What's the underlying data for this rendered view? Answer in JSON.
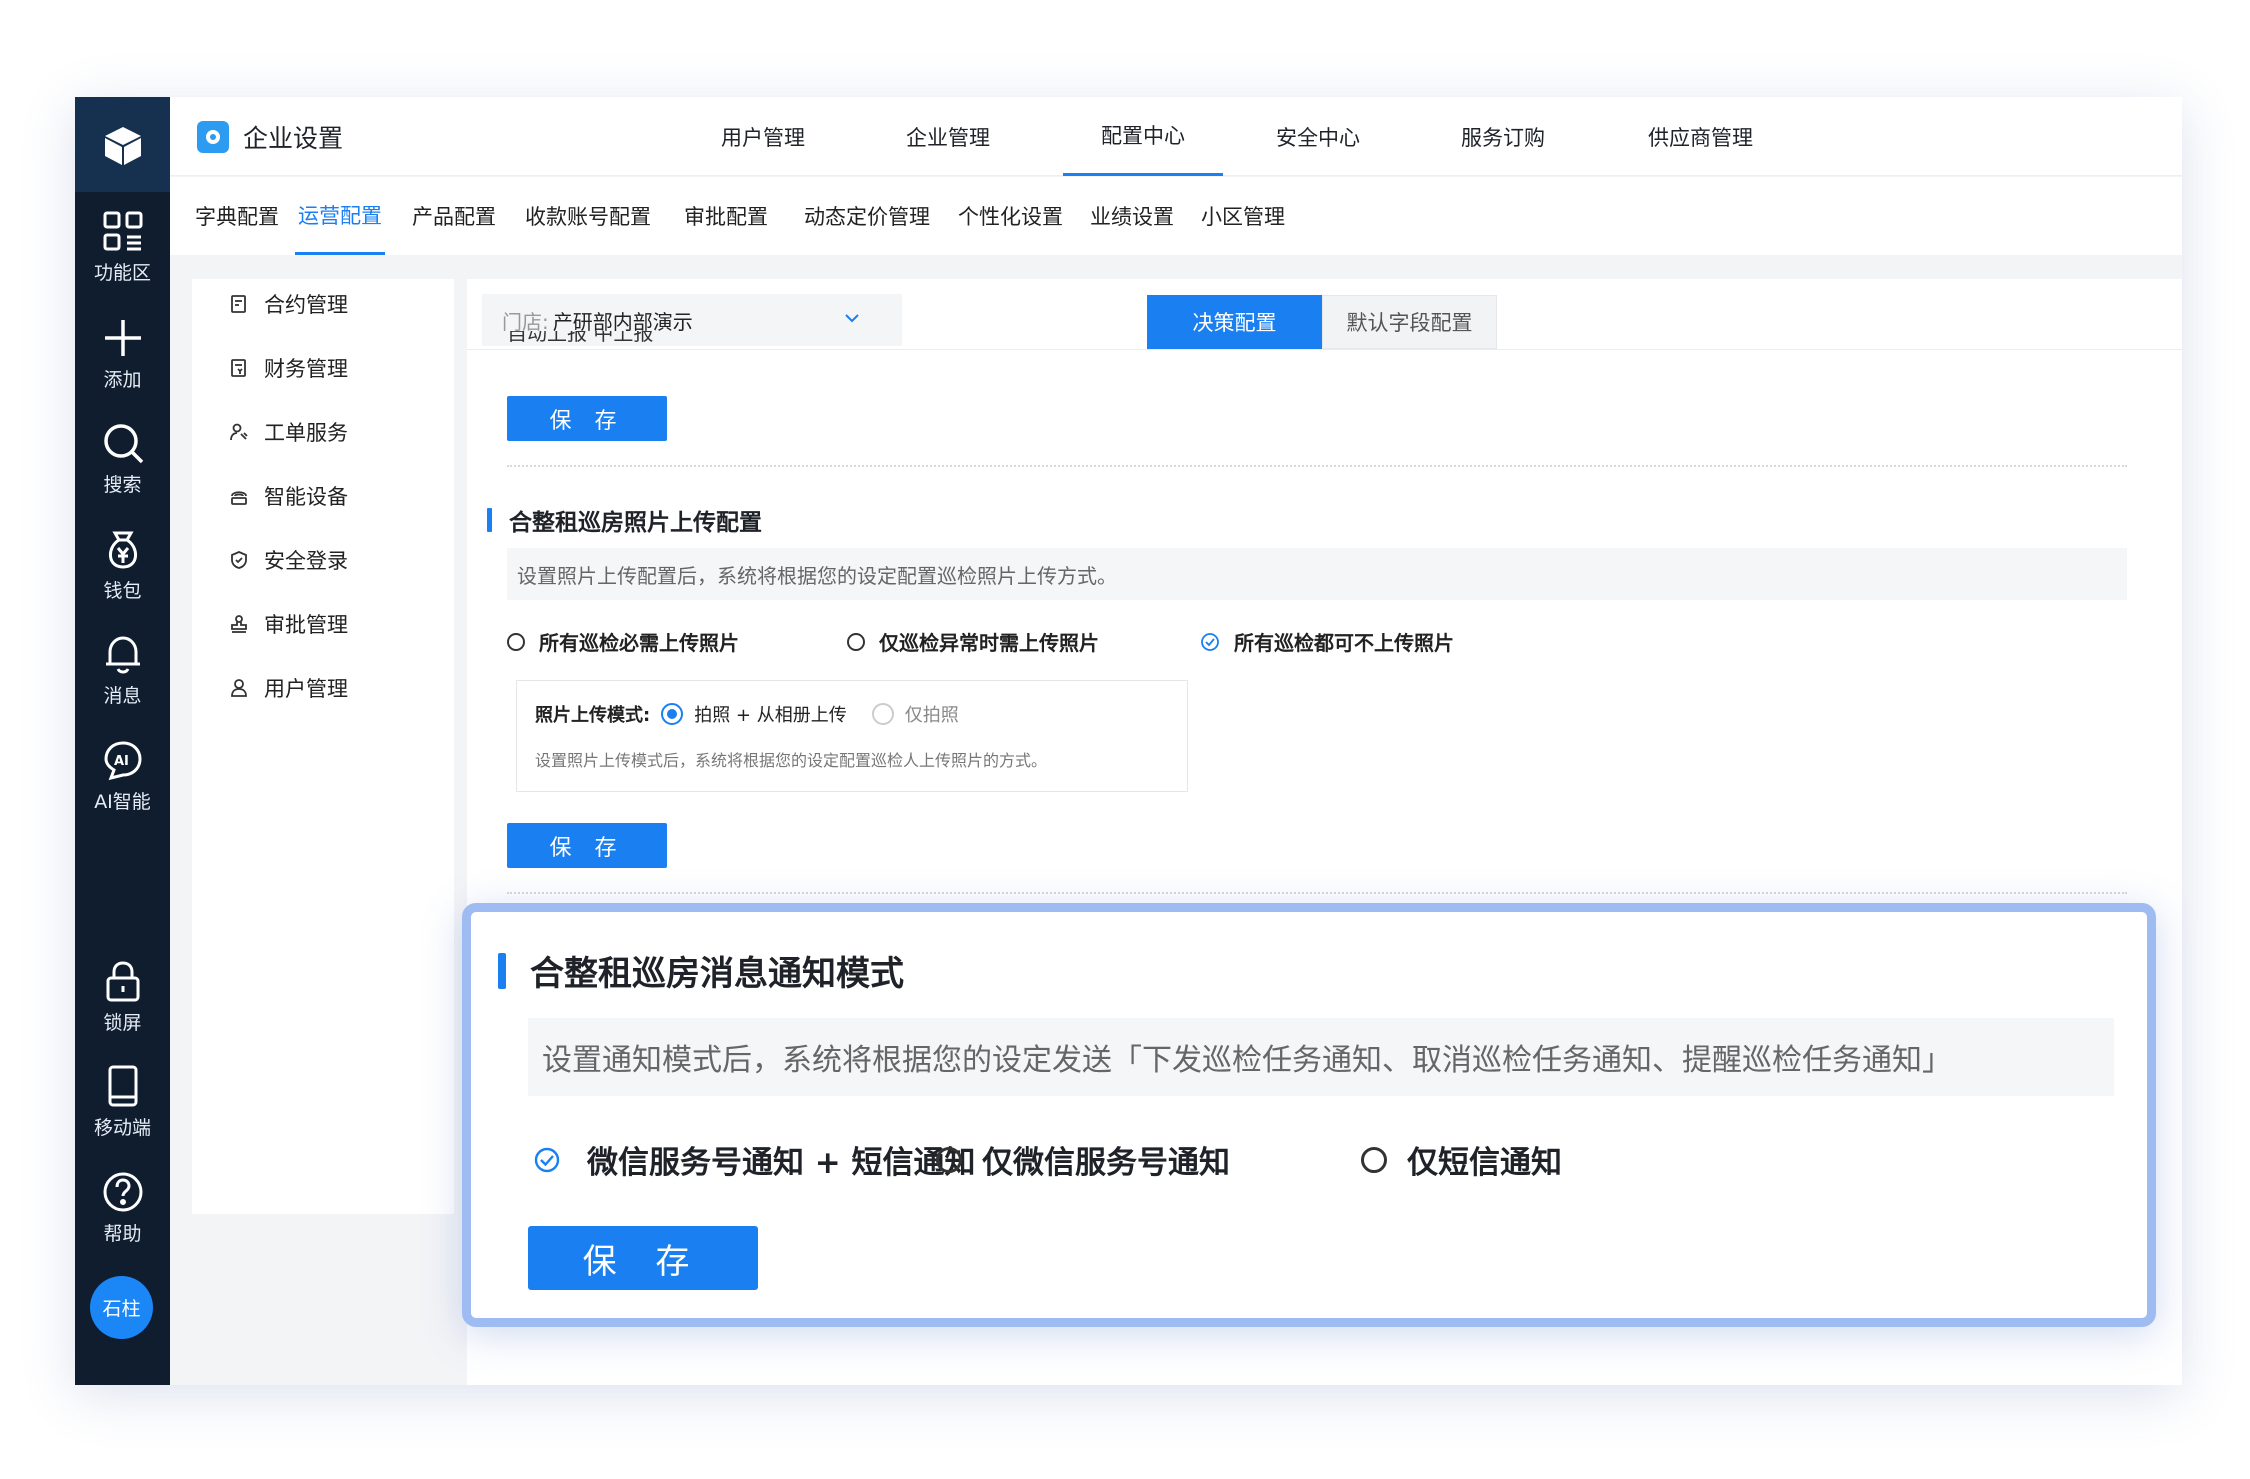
{
  "rail": {
    "items": [
      {
        "label": "功能区",
        "icon": "grid-icon"
      },
      {
        "label": "添加",
        "icon": "plus-icon"
      },
      {
        "label": "搜索",
        "icon": "search-icon"
      },
      {
        "label": "钱包",
        "icon": "wallet-icon"
      },
      {
        "label": "消息",
        "icon": "bell-icon"
      },
      {
        "label": "AI智能",
        "icon": "ai-icon"
      },
      {
        "label": "锁屏",
        "icon": "lock-icon"
      },
      {
        "label": "移动端",
        "icon": "phone-icon"
      },
      {
        "label": "帮助",
        "icon": "help-icon"
      }
    ],
    "avatar": "石柱"
  },
  "header": {
    "brand": "企业设置",
    "nav": [
      "用户管理",
      "企业管理",
      "配置中心",
      "安全中心",
      "服务订购",
      "供应商管理"
    ],
    "active_nav": "配置中心"
  },
  "subnav": {
    "tabs": [
      "字典配置",
      "运营配置",
      "产品配置",
      "收款账号配置",
      "审批配置",
      "动态定价管理",
      "个性化设置",
      "业绩设置",
      "小区管理"
    ],
    "active": "运营配置"
  },
  "sidemenu": {
    "items": [
      "合约管理",
      "财务管理",
      "工单服务",
      "智能设备",
      "安全登录",
      "审批管理",
      "用户管理"
    ]
  },
  "content": {
    "store_prefix": "门店:",
    "store_value": "产研部内部演示",
    "tabs": [
      "决策配置",
      "默认字段配置"
    ],
    "cut_text": "自动上报      中上报",
    "save_label": "保 存",
    "photo_section": {
      "title": "合整租巡房照片上传配置",
      "desc": "设置照片上传配置后，系统将根据您的设定配置巡检照片上传方式。",
      "options": [
        "所有巡检必需上传照片",
        "仅巡检异常时需上传照片",
        "所有巡检都可不上传照片"
      ],
      "selected": "所有巡检都可不上传照片",
      "mode_label": "照片上传模式:",
      "mode_options": [
        "拍照 + 从相册上传",
        "仅拍照"
      ],
      "mode_selected": "拍照 + 从相册上传",
      "mode_desc": "设置照片上传模式后，系统将根据您的设定配置巡检人上传照片的方式。"
    }
  },
  "popup": {
    "title": "合整租巡房消息通知模式",
    "desc": "设置通知模式后，系统将根据您的设定发送「下发巡检任务通知、取消巡检任务通知、提醒巡检任务通知」",
    "options": [
      "微信服务号通知 + 短信通知",
      "仅微信服务号通知",
      "仅短信通知"
    ],
    "selected": "微信服务号通知 + 短信通知",
    "save_label": "保 存"
  },
  "colors": {
    "primary": "#1a7ff0",
    "rail_bg": "#0f1d2f",
    "highlight_border": "#9fbcf2"
  }
}
